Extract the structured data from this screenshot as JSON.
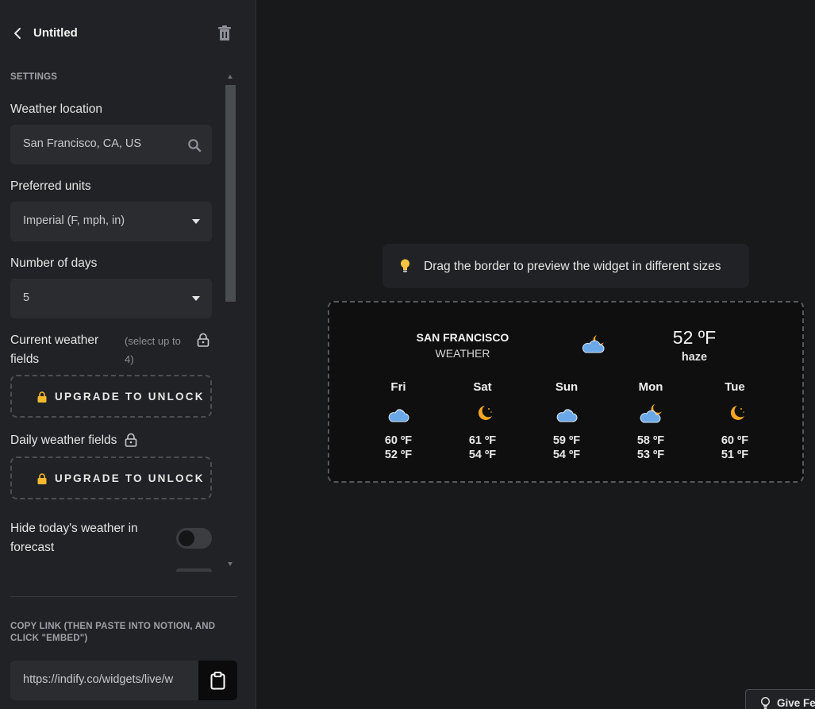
{
  "sidebar": {
    "title": "Untitled",
    "settings_label": "SETTINGS",
    "location": {
      "label": "Weather location",
      "value": "San Francisco, CA, US"
    },
    "units": {
      "label": "Preferred units",
      "value": "Imperial (F, mph, in)"
    },
    "days": {
      "label": "Number of days",
      "value": "5"
    },
    "current_fields": {
      "label_line1": "Current weather",
      "label_line2": "fields",
      "note_line1": "(select up to",
      "note_line2": "4)",
      "upgrade_label": "UPGRADE TO UNLOCK"
    },
    "daily_fields": {
      "label": "Daily weather fields",
      "upgrade_label": "UPGRADE TO UNLOCK"
    },
    "hide_today": {
      "label_line1": "Hide today's weather in",
      "label_line2": "forecast",
      "enabled": false
    },
    "copy_link": {
      "label": "COPY LINK (THEN PASTE INTO NOTION, AND CLICK \"EMBED\")",
      "value": "https://indify.co/widgets/live/w"
    }
  },
  "preview": {
    "hint": "Drag the border to preview the widget in different sizes",
    "widget": {
      "city": "SAN FRANCISCO",
      "city_sub": "WEATHER",
      "current_temp": "52 ºF",
      "current_desc": "haze",
      "current_icon": "partly-cloudy-night-icon",
      "days": [
        {
          "name": "Fri",
          "icon": "cloudy-icon",
          "hi": "60 ºF",
          "lo": "52 ºF"
        },
        {
          "name": "Sat",
          "icon": "moon-icon",
          "hi": "61 ºF",
          "lo": "54 ºF"
        },
        {
          "name": "Sun",
          "icon": "cloudy-icon",
          "hi": "59 ºF",
          "lo": "54 ºF"
        },
        {
          "name": "Mon",
          "icon": "partly-cloudy-night-icon",
          "hi": "58 ºF",
          "lo": "53 ºF"
        },
        {
          "name": "Tue",
          "icon": "moon-icon",
          "hi": "60 ºF",
          "lo": "51 ºF"
        }
      ]
    }
  },
  "feedback": {
    "label": "Give Fe"
  },
  "colors": {
    "background": "#18191b",
    "sidebar": "#202225",
    "cloud": "#6aa8e8",
    "moon": "#f5a623"
  }
}
